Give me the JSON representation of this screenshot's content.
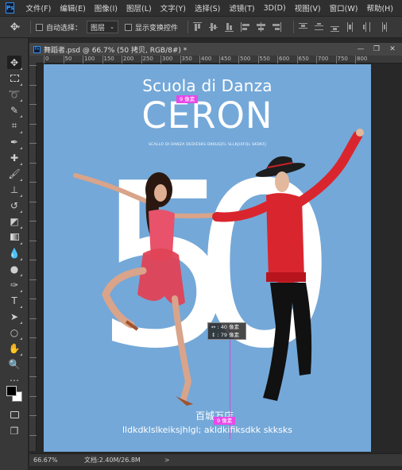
{
  "menu": {
    "app_icon_label": "Ps",
    "items": [
      "文件(F)",
      "编辑(E)",
      "图像(I)",
      "图层(L)",
      "文字(Y)",
      "选择(S)",
      "滤镜(T)",
      "3D(D)",
      "视图(V)",
      "窗口(W)",
      "帮助(H)"
    ]
  },
  "options": {
    "auto_select_label": "自动选择：",
    "auto_select_target": "图层",
    "show_transform_label": "显示变换控件"
  },
  "document": {
    "tab_title": "舞蹈者.psd @ 66.7% (50 拷贝, RGB/8#) *",
    "tab_icon_label": "Ps",
    "ruler_labels": [
      "0",
      "50",
      "100",
      "150",
      "200",
      "250",
      "300",
      "350",
      "400",
      "450",
      "500",
      "550",
      "600",
      "650",
      "700",
      "750",
      "800"
    ],
    "zoom": "66.67%",
    "doc_info": "文档:2.40M/26.8M",
    "status_arrow": ">"
  },
  "poster": {
    "subtitle": "Scuola di Danza",
    "title": "CERON",
    "tagline": "SCALLO DI DANZA DEDIESKS DKKUEJFL SLLKJUIFQL SKDKFJ",
    "number": "50",
    "store": "百城万店",
    "bottom_text": "lldkdklslkeiksjhlgl; akldkifiksdkk skksks"
  },
  "overlays": {
    "top_spacing": "9 像素",
    "bottom_spacing": "9 像素",
    "measure_w": "↔ : 40 像素",
    "measure_h": "↕ : 79 像素"
  },
  "colors": {
    "canvas_bg": "#74a8d8",
    "guide": "#e84ae8",
    "woman_dress": "#e8526a",
    "man_shirt": "#d9262e"
  }
}
